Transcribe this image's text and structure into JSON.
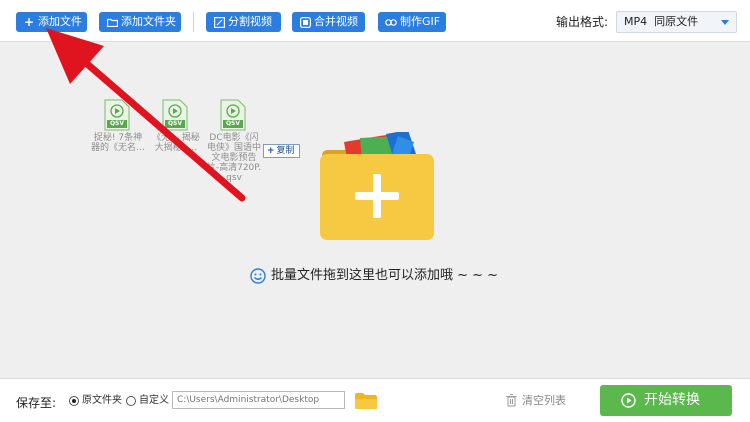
{
  "toolbar": {
    "add_file": "添加文件",
    "add_folder": "添加文件夹",
    "split_video": "分割视频",
    "merge_video": "合并视频",
    "make_gif": "制作GIF",
    "format_label": "输出格式:",
    "format_value": "MP4  同原文件"
  },
  "files": [
    {
      "badge": "QSV",
      "name": "捉秘! 7条神器的《无名…"
    },
    {
      "badge": "QSV",
      "name": "《无… 揭秘 大揭秘! …"
    },
    {
      "badge": "QSV",
      "name": "DC电影《闪电侠》国语中文电影预告片-高清720P.qsv"
    }
  ],
  "copy_tip": {
    "plus": "+",
    "label": "复制"
  },
  "hint": "批量文件拖到这里也可以添加哦 ~ ~ ~",
  "bottom": {
    "save_label": "保存至:",
    "option_original": "原文件夹",
    "option_custom": "自定义",
    "path_placeholder": "C:\\Users\\Administrator\\Desktop",
    "clear_list": "清空列表",
    "start": "开始转换"
  },
  "colors": {
    "accent": "#2b7ee0",
    "start": "#5bb84d",
    "arrow": "#e0141e",
    "folder": "#f7c842"
  }
}
